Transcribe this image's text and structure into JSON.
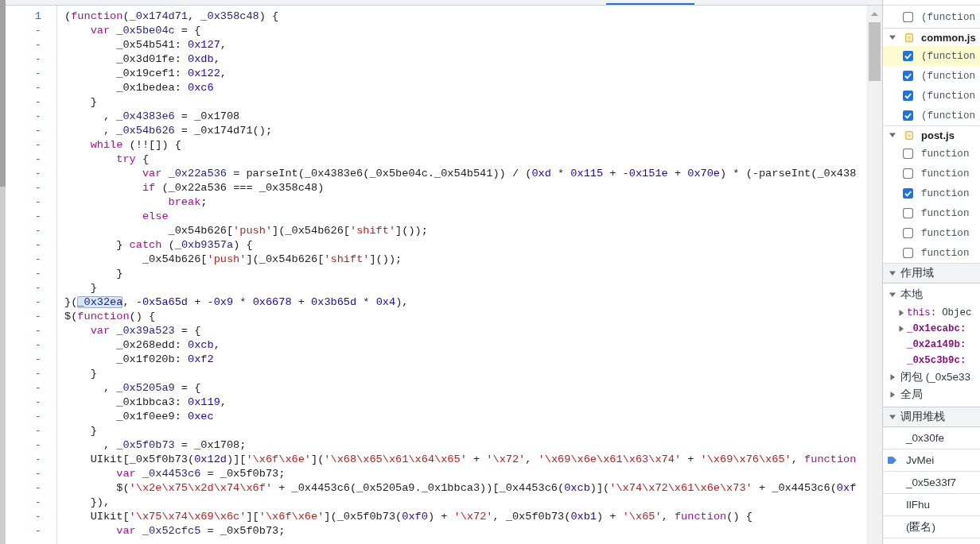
{
  "code": {
    "lines": [
      {
        "number": "1",
        "tokens": [
          {
            "kind": "plain",
            "text": "("
          },
          {
            "kind": "keyword",
            "text": "function"
          },
          {
            "kind": "plain",
            "text": "("
          },
          {
            "kind": "def",
            "text": "_0x174d71"
          },
          {
            "kind": "plain",
            "text": ", "
          },
          {
            "kind": "def",
            "text": "_0x358c48"
          },
          {
            "kind": "plain",
            "text": ") {"
          }
        ]
      },
      {
        "number": "-",
        "tokens": [
          {
            "kind": "keyword",
            "text": "    var"
          },
          {
            "kind": "def",
            "text": " _0x5be04c"
          },
          {
            "kind": "plain",
            "text": " = {"
          }
        ]
      },
      {
        "number": "-",
        "tokens": [
          {
            "kind": "plain",
            "text": "        _0x54b541: "
          },
          {
            "kind": "number",
            "text": "0x127"
          },
          {
            "kind": "plain",
            "text": ","
          }
        ]
      },
      {
        "number": "-",
        "tokens": [
          {
            "kind": "plain",
            "text": "        _0x3d01fe: "
          },
          {
            "kind": "number",
            "text": "0xdb"
          },
          {
            "kind": "plain",
            "text": ","
          }
        ]
      },
      {
        "number": "-",
        "tokens": [
          {
            "kind": "plain",
            "text": "        _0x19cef1: "
          },
          {
            "kind": "number",
            "text": "0x122"
          },
          {
            "kind": "plain",
            "text": ","
          }
        ]
      },
      {
        "number": "-",
        "tokens": [
          {
            "kind": "plain",
            "text": "        _0x1bedea: "
          },
          {
            "kind": "number",
            "text": "0xc6"
          }
        ]
      },
      {
        "number": "-",
        "tokens": [
          {
            "kind": "plain",
            "text": "    }"
          }
        ]
      },
      {
        "number": "-",
        "tokens": [
          {
            "kind": "plain",
            "text": "      , "
          },
          {
            "kind": "def",
            "text": "_0x4383e6"
          },
          {
            "kind": "plain",
            "text": " = _0x1708"
          }
        ]
      },
      {
        "number": "-",
        "tokens": [
          {
            "kind": "plain",
            "text": "      , "
          },
          {
            "kind": "def",
            "text": "_0x54b626"
          },
          {
            "kind": "plain",
            "text": " = _0x174d71();"
          }
        ]
      },
      {
        "number": "-",
        "tokens": [
          {
            "kind": "keyword",
            "text": "    while"
          },
          {
            "kind": "plain",
            "text": " (!![]) {"
          }
        ]
      },
      {
        "number": "-",
        "tokens": [
          {
            "kind": "keyword",
            "text": "        try"
          },
          {
            "kind": "plain",
            "text": " {"
          }
        ]
      },
      {
        "number": "-",
        "tokens": [
          {
            "kind": "keyword",
            "text": "            var"
          },
          {
            "kind": "def",
            "text": " _0x22a536"
          },
          {
            "kind": "plain",
            "text": " = parseInt(_0x4383e6(_0x5be04c._0x54b541)) / ("
          },
          {
            "kind": "number",
            "text": "0xd"
          },
          {
            "kind": "plain",
            "text": " * "
          },
          {
            "kind": "number",
            "text": "0x115"
          },
          {
            "kind": "plain",
            "text": " + -"
          },
          {
            "kind": "number",
            "text": "0x151e"
          },
          {
            "kind": "plain",
            "text": " + "
          },
          {
            "kind": "number",
            "text": "0x70e"
          },
          {
            "kind": "plain",
            "text": ") * (-parseInt(_0x438"
          }
        ]
      },
      {
        "number": "-",
        "tokens": [
          {
            "kind": "keyword",
            "text": "            if"
          },
          {
            "kind": "plain",
            "text": " (_0x22a536 === _0x358c48)"
          }
        ]
      },
      {
        "number": "-",
        "tokens": [
          {
            "kind": "keyword",
            "text": "                break"
          },
          {
            "kind": "plain",
            "text": ";"
          }
        ]
      },
      {
        "number": "-",
        "tokens": [
          {
            "kind": "keyword",
            "text": "            else"
          }
        ]
      },
      {
        "number": "-",
        "tokens": [
          {
            "kind": "plain",
            "text": "                _0x54b626["
          },
          {
            "kind": "string",
            "text": "'push'"
          },
          {
            "kind": "plain",
            "text": "](_0x54b626["
          },
          {
            "kind": "string",
            "text": "'shift'"
          },
          {
            "kind": "plain",
            "text": "]());"
          }
        ]
      },
      {
        "number": "-",
        "tokens": [
          {
            "kind": "plain",
            "text": "        } "
          },
          {
            "kind": "keyword",
            "text": "catch"
          },
          {
            "kind": "plain",
            "text": " ("
          },
          {
            "kind": "def",
            "text": "_0xb9357a"
          },
          {
            "kind": "plain",
            "text": ") {"
          }
        ]
      },
      {
        "number": "-",
        "tokens": [
          {
            "kind": "plain",
            "text": "            _0x54b626["
          },
          {
            "kind": "string",
            "text": "'push'"
          },
          {
            "kind": "plain",
            "text": "](_0x54b626["
          },
          {
            "kind": "string",
            "text": "'shift'"
          },
          {
            "kind": "plain",
            "text": "]());"
          }
        ]
      },
      {
        "number": "-",
        "tokens": [
          {
            "kind": "plain",
            "text": "        }"
          }
        ]
      },
      {
        "number": "-",
        "tokens": [
          {
            "kind": "plain",
            "text": "    }"
          }
        ]
      },
      {
        "number": "-",
        "tokens": [
          {
            "kind": "plain",
            "text": "}("
          },
          {
            "kind": "highlight",
            "text": "_0x32ea"
          },
          {
            "kind": "plain",
            "text": ", -"
          },
          {
            "kind": "number",
            "text": "0x5a65d"
          },
          {
            "kind": "plain",
            "text": " + -"
          },
          {
            "kind": "number",
            "text": "0x9"
          },
          {
            "kind": "plain",
            "text": " * "
          },
          {
            "kind": "number",
            "text": "0x6678"
          },
          {
            "kind": "plain",
            "text": " + "
          },
          {
            "kind": "number",
            "text": "0x3b65d"
          },
          {
            "kind": "plain",
            "text": " * "
          },
          {
            "kind": "number",
            "text": "0x4"
          },
          {
            "kind": "plain",
            "text": "),"
          }
        ]
      },
      {
        "number": "-",
        "tokens": [
          {
            "kind": "plain",
            "text": "$("
          },
          {
            "kind": "keyword",
            "text": "function"
          },
          {
            "kind": "plain",
            "text": "() {"
          }
        ]
      },
      {
        "number": "-",
        "tokens": [
          {
            "kind": "keyword",
            "text": "    var"
          },
          {
            "kind": "def",
            "text": " _0x39a523"
          },
          {
            "kind": "plain",
            "text": " = {"
          }
        ]
      },
      {
        "number": "-",
        "tokens": [
          {
            "kind": "plain",
            "text": "        _0x268edd: "
          },
          {
            "kind": "number",
            "text": "0xcb"
          },
          {
            "kind": "plain",
            "text": ","
          }
        ]
      },
      {
        "number": "-",
        "tokens": [
          {
            "kind": "plain",
            "text": "        _0x1f020b: "
          },
          {
            "kind": "number",
            "text": "0xf2"
          }
        ]
      },
      {
        "number": "-",
        "tokens": [
          {
            "kind": "plain",
            "text": "    }"
          }
        ]
      },
      {
        "number": "-",
        "tokens": [
          {
            "kind": "plain",
            "text": "      , "
          },
          {
            "kind": "def",
            "text": "_0x5205a9"
          },
          {
            "kind": "plain",
            "text": " = {"
          }
        ]
      },
      {
        "number": "-",
        "tokens": [
          {
            "kind": "plain",
            "text": "        _0x1bbca3: "
          },
          {
            "kind": "number",
            "text": "0x119"
          },
          {
            "kind": "plain",
            "text": ","
          }
        ]
      },
      {
        "number": "-",
        "tokens": [
          {
            "kind": "plain",
            "text": "        _0x1f0ee9: "
          },
          {
            "kind": "number",
            "text": "0xec"
          }
        ]
      },
      {
        "number": "-",
        "tokens": [
          {
            "kind": "plain",
            "text": "    }"
          }
        ]
      },
      {
        "number": "-",
        "tokens": [
          {
            "kind": "plain",
            "text": "      , "
          },
          {
            "kind": "def",
            "text": "_0x5f0b73"
          },
          {
            "kind": "plain",
            "text": " = _0x1708;"
          }
        ]
      },
      {
        "number": "-",
        "tokens": [
          {
            "kind": "plain",
            "text": "    UIkit[_0x5f0b73("
          },
          {
            "kind": "number",
            "text": "0x12d"
          },
          {
            "kind": "plain",
            "text": ")]["
          },
          {
            "kind": "string",
            "text": "'\\x6f\\x6e'"
          },
          {
            "kind": "plain",
            "text": "]("
          },
          {
            "kind": "string",
            "text": "'\\x68\\x65\\x61\\x64\\x65'"
          },
          {
            "kind": "plain",
            "text": " + "
          },
          {
            "kind": "string",
            "text": "'\\x72'"
          },
          {
            "kind": "plain",
            "text": ", "
          },
          {
            "kind": "string",
            "text": "'\\x69\\x6e\\x61\\x63\\x74'"
          },
          {
            "kind": "plain",
            "text": " + "
          },
          {
            "kind": "string",
            "text": "'\\x69\\x76\\x65'"
          },
          {
            "kind": "plain",
            "text": ", "
          },
          {
            "kind": "keyword",
            "text": "function"
          }
        ]
      },
      {
        "number": "-",
        "tokens": [
          {
            "kind": "keyword",
            "text": "        var"
          },
          {
            "kind": "def",
            "text": " _0x4453c6"
          },
          {
            "kind": "plain",
            "text": " = _0x5f0b73;"
          }
        ]
      },
      {
        "number": "-",
        "tokens": [
          {
            "kind": "plain",
            "text": "        $("
          },
          {
            "kind": "string",
            "text": "'\\x2e\\x75\\x2d\\x74\\x6f'"
          },
          {
            "kind": "plain",
            "text": " + _0x4453c6(_0x5205a9._0x1bbca3))[_0x4453c6("
          },
          {
            "kind": "number",
            "text": "0xcb"
          },
          {
            "kind": "plain",
            "text": ")]("
          },
          {
            "kind": "string",
            "text": "'\\x74\\x72\\x61\\x6e\\x73'"
          },
          {
            "kind": "plain",
            "text": " + _0x4453c6("
          },
          {
            "kind": "number",
            "text": "0xf"
          }
        ]
      },
      {
        "number": "-",
        "tokens": [
          {
            "kind": "plain",
            "text": "    }),"
          }
        ]
      },
      {
        "number": "-",
        "tokens": [
          {
            "kind": "plain",
            "text": "    UIkit["
          },
          {
            "kind": "string",
            "text": "'\\x75\\x74\\x69\\x6c'"
          },
          {
            "kind": "plain",
            "text": "]["
          },
          {
            "kind": "string",
            "text": "'\\x6f\\x6e'"
          },
          {
            "kind": "plain",
            "text": "](_0x5f0b73("
          },
          {
            "kind": "number",
            "text": "0xf0"
          },
          {
            "kind": "plain",
            "text": ") + "
          },
          {
            "kind": "string",
            "text": "'\\x72'"
          },
          {
            "kind": "plain",
            "text": ", _0x5f0b73("
          },
          {
            "kind": "number",
            "text": "0xb1"
          },
          {
            "kind": "plain",
            "text": ") + "
          },
          {
            "kind": "string",
            "text": "'\\x65'"
          },
          {
            "kind": "plain",
            "text": ", "
          },
          {
            "kind": "keyword",
            "text": "function"
          },
          {
            "kind": "plain",
            "text": "() {"
          }
        ]
      },
      {
        "number": "-",
        "tokens": [
          {
            "kind": "keyword",
            "text": "        var"
          },
          {
            "kind": "def",
            "text": " _0x52cfc5"
          },
          {
            "kind": "plain",
            "text": " = _0x5f0b73;"
          }
        ]
      }
    ]
  },
  "breakpoints": {
    "loose_entries": [
      {
        "label": "(function",
        "checked": false,
        "selected": false
      }
    ],
    "files": [
      {
        "name": "common.js",
        "expanded": true,
        "entries": [
          {
            "label": "(function",
            "checked": true,
            "selected": true
          },
          {
            "label": "(function",
            "checked": true,
            "selected": false
          },
          {
            "label": "(function",
            "checked": true,
            "selected": false
          },
          {
            "label": "(function",
            "checked": true,
            "selected": false
          }
        ]
      },
      {
        "name": "post.js",
        "expanded": true,
        "entries": [
          {
            "label": "function",
            "checked": false,
            "selected": false
          },
          {
            "label": "function",
            "checked": false,
            "selected": false
          },
          {
            "label": "function",
            "checked": true,
            "selected": false
          },
          {
            "label": "function",
            "checked": false,
            "selected": false
          },
          {
            "label": "function",
            "checked": false,
            "selected": false
          },
          {
            "label": "function",
            "checked": false,
            "selected": false
          }
        ]
      }
    ]
  },
  "scope": {
    "title": "作用域",
    "expanded": true,
    "children": [
      {
        "label": "本地",
        "expanded": true,
        "children": [
          {
            "name": "this:",
            "value": "Objec",
            "expandable": true,
            "own": false
          },
          {
            "name": "_0x1ecabc:",
            "expandable": true,
            "own": true
          },
          {
            "name": "_0x2a149b:",
            "expandable": false,
            "own": true
          },
          {
            "name": "_0x5c3b9c:",
            "expandable": false,
            "own": true
          }
        ]
      },
      {
        "label": "闭包 (_0x5e33",
        "expanded": false
      },
      {
        "label": "全局",
        "expanded": false
      }
    ]
  },
  "call_stack": {
    "title": "调用堆栈",
    "expanded": true,
    "frames": [
      {
        "label": "_0x30fe",
        "current": false
      },
      {
        "label": "JvMei",
        "current": true
      },
      {
        "label": "_0x5e33f7",
        "current": false
      },
      {
        "label": "IlFhu",
        "current": false
      },
      {
        "label": "(匿名)",
        "current": false
      }
    ]
  }
}
